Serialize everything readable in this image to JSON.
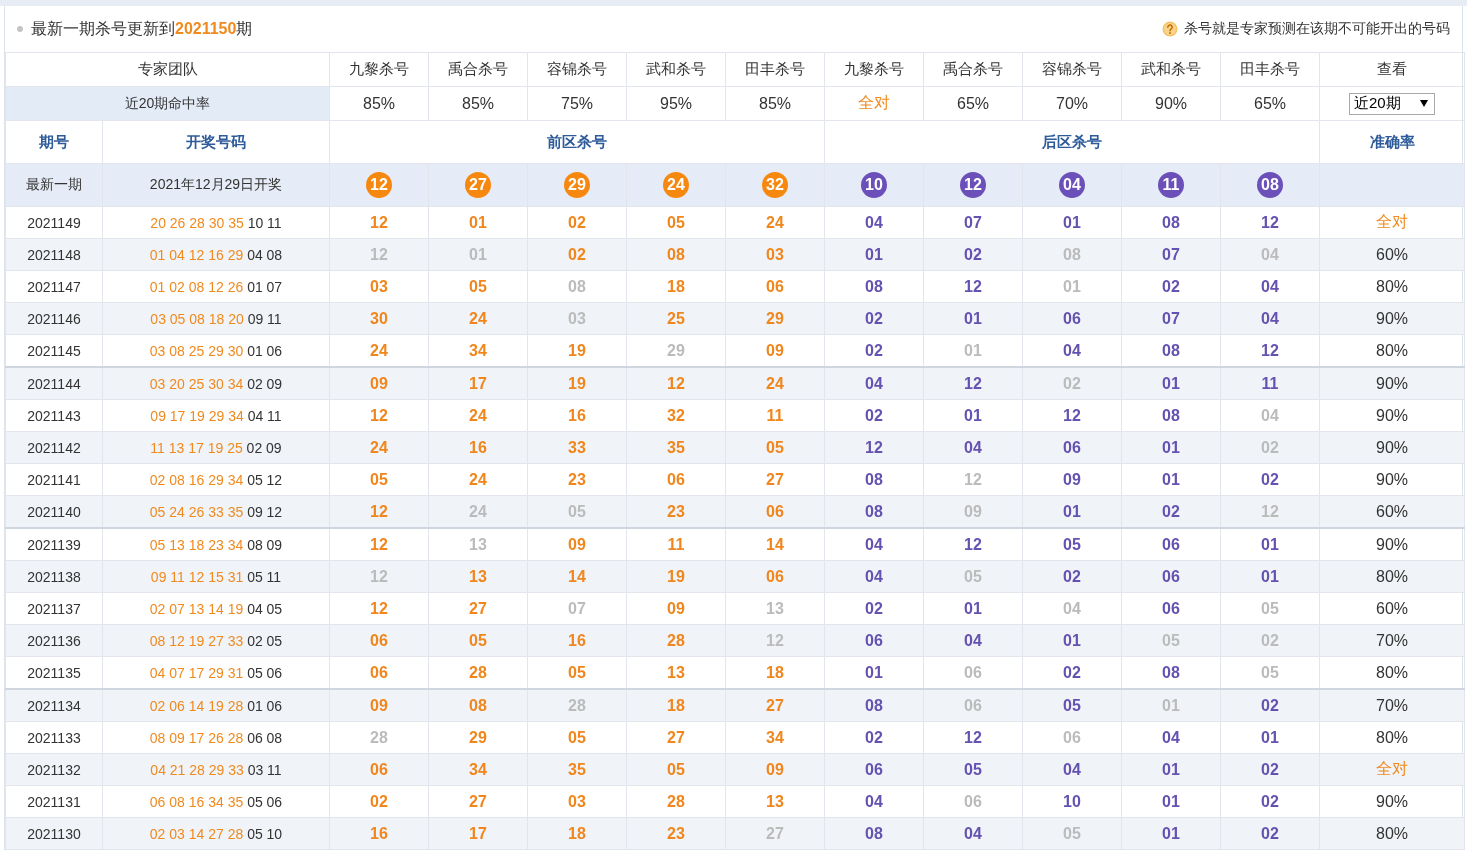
{
  "notice": {
    "text": "最新一期杀号更新到**2021150**期"
  },
  "hint": {
    "text": "杀号就是专家预测在该期不可能开出的号码"
  },
  "experts": {
    "label": "专家团队",
    "columns": [
      "九黎杀号",
      "禹合杀号",
      "容锦杀号",
      "武和杀号",
      "田丰杀号",
      "九黎杀号",
      "禹合杀号",
      "容锦杀号",
      "武和杀号",
      "田丰杀号"
    ],
    "view_label": "查看"
  },
  "hit_rate": {
    "label": "近20期命中率",
    "values": [
      {
        "text": "85%",
        "perfect": false
      },
      {
        "text": "85%",
        "perfect": false
      },
      {
        "text": "75%",
        "perfect": false
      },
      {
        "text": "95%",
        "perfect": false
      },
      {
        "text": "85%",
        "perfect": false
      },
      {
        "text": "全对",
        "perfect": true
      },
      {
        "text": "65%",
        "perfect": false
      },
      {
        "text": "70%",
        "perfect": false
      },
      {
        "text": "90%",
        "perfect": false
      },
      {
        "text": "65%",
        "perfect": false
      }
    ],
    "period_select": {
      "value": "近20期"
    }
  },
  "section_headers": {
    "period": "期号",
    "draw": "开奖号码",
    "front": "前区杀号",
    "back": "后区杀号",
    "accuracy": "准确率"
  },
  "latest": {
    "period": "最新一期",
    "draw_date": "2021年12月29日开奖",
    "front_kills": [
      "12",
      "27",
      "29",
      "24",
      "32"
    ],
    "back_kills": [
      "10",
      "12",
      "04",
      "11",
      "08"
    ]
  },
  "rows": [
    {
      "period": "2021149",
      "front": "20 26 28 30 35",
      "back": "10 11",
      "front_kills": [
        {
          "n": "12",
          "failed": false
        },
        {
          "n": "01",
          "failed": false
        },
        {
          "n": "02",
          "failed": false
        },
        {
          "n": "05",
          "failed": false
        },
        {
          "n": "24",
          "failed": false
        }
      ],
      "back_kills": [
        {
          "n": "04",
          "failed": false
        },
        {
          "n": "07",
          "failed": false
        },
        {
          "n": "01",
          "failed": false
        },
        {
          "n": "08",
          "failed": false
        },
        {
          "n": "12",
          "failed": false
        }
      ],
      "accuracy": {
        "text": "全对",
        "perfect": true
      }
    },
    {
      "period": "2021148",
      "front": "01 04 12 16 29",
      "back": "04 08",
      "front_kills": [
        {
          "n": "12",
          "failed": true
        },
        {
          "n": "01",
          "failed": true
        },
        {
          "n": "02",
          "failed": false
        },
        {
          "n": "08",
          "failed": false
        },
        {
          "n": "03",
          "failed": false
        }
      ],
      "back_kills": [
        {
          "n": "01",
          "failed": false
        },
        {
          "n": "02",
          "failed": false
        },
        {
          "n": "08",
          "failed": true
        },
        {
          "n": "07",
          "failed": false
        },
        {
          "n": "04",
          "failed": true
        }
      ],
      "accuracy": {
        "text": "60%",
        "perfect": false
      }
    },
    {
      "period": "2021147",
      "front": "01 02 08 12 26",
      "back": "01 07",
      "front_kills": [
        {
          "n": "03",
          "failed": false
        },
        {
          "n": "05",
          "failed": false
        },
        {
          "n": "08",
          "failed": true
        },
        {
          "n": "18",
          "failed": false
        },
        {
          "n": "06",
          "failed": false
        }
      ],
      "back_kills": [
        {
          "n": "08",
          "failed": false
        },
        {
          "n": "12",
          "failed": false
        },
        {
          "n": "01",
          "failed": true
        },
        {
          "n": "02",
          "failed": false
        },
        {
          "n": "04",
          "failed": false
        }
      ],
      "accuracy": {
        "text": "80%",
        "perfect": false
      }
    },
    {
      "period": "2021146",
      "front": "03 05 08 18 20",
      "back": "09 11",
      "front_kills": [
        {
          "n": "30",
          "failed": false
        },
        {
          "n": "24",
          "failed": false
        },
        {
          "n": "03",
          "failed": true
        },
        {
          "n": "25",
          "failed": false
        },
        {
          "n": "29",
          "failed": false
        }
      ],
      "back_kills": [
        {
          "n": "02",
          "failed": false
        },
        {
          "n": "01",
          "failed": false
        },
        {
          "n": "06",
          "failed": false
        },
        {
          "n": "07",
          "failed": false
        },
        {
          "n": "04",
          "failed": false
        }
      ],
      "accuracy": {
        "text": "90%",
        "perfect": false
      }
    },
    {
      "period": "2021145",
      "front": "03 08 25 29 30",
      "back": "01 06",
      "front_kills": [
        {
          "n": "24",
          "failed": false
        },
        {
          "n": "34",
          "failed": false
        },
        {
          "n": "19",
          "failed": false
        },
        {
          "n": "29",
          "failed": true
        },
        {
          "n": "09",
          "failed": false
        }
      ],
      "back_kills": [
        {
          "n": "02",
          "failed": false
        },
        {
          "n": "01",
          "failed": true
        },
        {
          "n": "04",
          "failed": false
        },
        {
          "n": "08",
          "failed": false
        },
        {
          "n": "12",
          "failed": false
        }
      ],
      "accuracy": {
        "text": "80%",
        "perfect": false
      }
    },
    {
      "period": "2021144",
      "front": "03 20 25 30 34",
      "back": "02 09",
      "front_kills": [
        {
          "n": "09",
          "failed": false
        },
        {
          "n": "17",
          "failed": false
        },
        {
          "n": "19",
          "failed": false
        },
        {
          "n": "12",
          "failed": false
        },
        {
          "n": "24",
          "failed": false
        }
      ],
      "back_kills": [
        {
          "n": "04",
          "failed": false
        },
        {
          "n": "12",
          "failed": false
        },
        {
          "n": "02",
          "failed": true
        },
        {
          "n": "01",
          "failed": false
        },
        {
          "n": "11",
          "failed": false
        }
      ],
      "accuracy": {
        "text": "90%",
        "perfect": false
      }
    },
    {
      "period": "2021143",
      "front": "09 17 19 29 34",
      "back": "04 11",
      "front_kills": [
        {
          "n": "12",
          "failed": false
        },
        {
          "n": "24",
          "failed": false
        },
        {
          "n": "16",
          "failed": false
        },
        {
          "n": "32",
          "failed": false
        },
        {
          "n": "11",
          "failed": false
        }
      ],
      "back_kills": [
        {
          "n": "02",
          "failed": false
        },
        {
          "n": "01",
          "failed": false
        },
        {
          "n": "12",
          "failed": false
        },
        {
          "n": "08",
          "failed": false
        },
        {
          "n": "04",
          "failed": true
        }
      ],
      "accuracy": {
        "text": "90%",
        "perfect": false
      }
    },
    {
      "period": "2021142",
      "front": "11 13 17 19 25",
      "back": "02 09",
      "front_kills": [
        {
          "n": "24",
          "failed": false
        },
        {
          "n": "16",
          "failed": false
        },
        {
          "n": "33",
          "failed": false
        },
        {
          "n": "35",
          "failed": false
        },
        {
          "n": "05",
          "failed": false
        }
      ],
      "back_kills": [
        {
          "n": "12",
          "failed": false
        },
        {
          "n": "04",
          "failed": false
        },
        {
          "n": "06",
          "failed": false
        },
        {
          "n": "01",
          "failed": false
        },
        {
          "n": "02",
          "failed": true
        }
      ],
      "accuracy": {
        "text": "90%",
        "perfect": false
      }
    },
    {
      "period": "2021141",
      "front": "02 08 16 29 34",
      "back": "05 12",
      "front_kills": [
        {
          "n": "05",
          "failed": false
        },
        {
          "n": "24",
          "failed": false
        },
        {
          "n": "23",
          "failed": false
        },
        {
          "n": "06",
          "failed": false
        },
        {
          "n": "27",
          "failed": false
        }
      ],
      "back_kills": [
        {
          "n": "08",
          "failed": false
        },
        {
          "n": "12",
          "failed": true
        },
        {
          "n": "09",
          "failed": false
        },
        {
          "n": "01",
          "failed": false
        },
        {
          "n": "02",
          "failed": false
        }
      ],
      "accuracy": {
        "text": "90%",
        "perfect": false
      }
    },
    {
      "period": "2021140",
      "front": "05 24 26 33 35",
      "back": "09 12",
      "front_kills": [
        {
          "n": "12",
          "failed": false
        },
        {
          "n": "24",
          "failed": true
        },
        {
          "n": "05",
          "failed": true
        },
        {
          "n": "23",
          "failed": false
        },
        {
          "n": "06",
          "failed": false
        }
      ],
      "back_kills": [
        {
          "n": "08",
          "failed": false
        },
        {
          "n": "09",
          "failed": true
        },
        {
          "n": "01",
          "failed": false
        },
        {
          "n": "02",
          "failed": false
        },
        {
          "n": "12",
          "failed": true
        }
      ],
      "accuracy": {
        "text": "60%",
        "perfect": false
      }
    },
    {
      "period": "2021139",
      "front": "05 13 18 23 34",
      "back": "08 09",
      "front_kills": [
        {
          "n": "12",
          "failed": false
        },
        {
          "n": "13",
          "failed": true
        },
        {
          "n": "09",
          "failed": false
        },
        {
          "n": "11",
          "failed": false
        },
        {
          "n": "14",
          "failed": false
        }
      ],
      "back_kills": [
        {
          "n": "04",
          "failed": false
        },
        {
          "n": "12",
          "failed": false
        },
        {
          "n": "05",
          "failed": false
        },
        {
          "n": "06",
          "failed": false
        },
        {
          "n": "01",
          "failed": false
        }
      ],
      "accuracy": {
        "text": "90%",
        "perfect": false
      }
    },
    {
      "period": "2021138",
      "front": "09 11 12 15 31",
      "back": "05 11",
      "front_kills": [
        {
          "n": "12",
          "failed": true
        },
        {
          "n": "13",
          "failed": false
        },
        {
          "n": "14",
          "failed": false
        },
        {
          "n": "19",
          "failed": false
        },
        {
          "n": "06",
          "failed": false
        }
      ],
      "back_kills": [
        {
          "n": "04",
          "failed": false
        },
        {
          "n": "05",
          "failed": true
        },
        {
          "n": "02",
          "failed": false
        },
        {
          "n": "06",
          "failed": false
        },
        {
          "n": "01",
          "failed": false
        }
      ],
      "accuracy": {
        "text": "80%",
        "perfect": false
      }
    },
    {
      "period": "2021137",
      "front": "02 07 13 14 19",
      "back": "04 05",
      "front_kills": [
        {
          "n": "12",
          "failed": false
        },
        {
          "n": "27",
          "failed": false
        },
        {
          "n": "07",
          "failed": true
        },
        {
          "n": "09",
          "failed": false
        },
        {
          "n": "13",
          "failed": true
        }
      ],
      "back_kills": [
        {
          "n": "02",
          "failed": false
        },
        {
          "n": "01",
          "failed": false
        },
        {
          "n": "04",
          "failed": true
        },
        {
          "n": "06",
          "failed": false
        },
        {
          "n": "05",
          "failed": true
        }
      ],
      "accuracy": {
        "text": "60%",
        "perfect": false
      }
    },
    {
      "period": "2021136",
      "front": "08 12 19 27 33",
      "back": "02 05",
      "front_kills": [
        {
          "n": "06",
          "failed": false
        },
        {
          "n": "05",
          "failed": false
        },
        {
          "n": "16",
          "failed": false
        },
        {
          "n": "28",
          "failed": false
        },
        {
          "n": "12",
          "failed": true
        }
      ],
      "back_kills": [
        {
          "n": "06",
          "failed": false
        },
        {
          "n": "04",
          "failed": false
        },
        {
          "n": "01",
          "failed": false
        },
        {
          "n": "05",
          "failed": true
        },
        {
          "n": "02",
          "failed": true
        }
      ],
      "accuracy": {
        "text": "70%",
        "perfect": false
      }
    },
    {
      "period": "2021135",
      "front": "04 07 17 29 31",
      "back": "05 06",
      "front_kills": [
        {
          "n": "06",
          "failed": false
        },
        {
          "n": "28",
          "failed": false
        },
        {
          "n": "05",
          "failed": false
        },
        {
          "n": "13",
          "failed": false
        },
        {
          "n": "18",
          "failed": false
        }
      ],
      "back_kills": [
        {
          "n": "01",
          "failed": false
        },
        {
          "n": "06",
          "failed": true
        },
        {
          "n": "02",
          "failed": false
        },
        {
          "n": "08",
          "failed": false
        },
        {
          "n": "05",
          "failed": true
        }
      ],
      "accuracy": {
        "text": "80%",
        "perfect": false
      }
    },
    {
      "period": "2021134",
      "front": "02 06 14 19 28",
      "back": "01 06",
      "front_kills": [
        {
          "n": "09",
          "failed": false
        },
        {
          "n": "08",
          "failed": false
        },
        {
          "n": "28",
          "failed": true
        },
        {
          "n": "18",
          "failed": false
        },
        {
          "n": "27",
          "failed": false
        }
      ],
      "back_kills": [
        {
          "n": "08",
          "failed": false
        },
        {
          "n": "06",
          "failed": true
        },
        {
          "n": "05",
          "failed": false
        },
        {
          "n": "01",
          "failed": true
        },
        {
          "n": "02",
          "failed": false
        }
      ],
      "accuracy": {
        "text": "70%",
        "perfect": false
      }
    },
    {
      "period": "2021133",
      "front": "08 09 17 26 28",
      "back": "06 08",
      "front_kills": [
        {
          "n": "28",
          "failed": true
        },
        {
          "n": "29",
          "failed": false
        },
        {
          "n": "05",
          "failed": false
        },
        {
          "n": "27",
          "failed": false
        },
        {
          "n": "34",
          "failed": false
        }
      ],
      "back_kills": [
        {
          "n": "02",
          "failed": false
        },
        {
          "n": "12",
          "failed": false
        },
        {
          "n": "06",
          "failed": true
        },
        {
          "n": "04",
          "failed": false
        },
        {
          "n": "01",
          "failed": false
        }
      ],
      "accuracy": {
        "text": "80%",
        "perfect": false
      }
    },
    {
      "period": "2021132",
      "front": "04 21 28 29 33",
      "back": "03 11",
      "front_kills": [
        {
          "n": "06",
          "failed": false
        },
        {
          "n": "34",
          "failed": false
        },
        {
          "n": "35",
          "failed": false
        },
        {
          "n": "05",
          "failed": false
        },
        {
          "n": "09",
          "failed": false
        }
      ],
      "back_kills": [
        {
          "n": "06",
          "failed": false
        },
        {
          "n": "05",
          "failed": false
        },
        {
          "n": "04",
          "failed": false
        },
        {
          "n": "01",
          "failed": false
        },
        {
          "n": "02",
          "failed": false
        }
      ],
      "accuracy": {
        "text": "全对",
        "perfect": true
      }
    },
    {
      "period": "2021131",
      "front": "06 08 16 34 35",
      "back": "05 06",
      "front_kills": [
        {
          "n": "02",
          "failed": false
        },
        {
          "n": "27",
          "failed": false
        },
        {
          "n": "03",
          "failed": false
        },
        {
          "n": "28",
          "failed": false
        },
        {
          "n": "13",
          "failed": false
        }
      ],
      "back_kills": [
        {
          "n": "04",
          "failed": false
        },
        {
          "n": "06",
          "failed": true
        },
        {
          "n": "10",
          "failed": false
        },
        {
          "n": "01",
          "failed": false
        },
        {
          "n": "02",
          "failed": false
        }
      ],
      "accuracy": {
        "text": "90%",
        "perfect": false
      }
    },
    {
      "period": "2021130",
      "front": "02 03 14 27 28",
      "back": "05 10",
      "front_kills": [
        {
          "n": "16",
          "failed": false
        },
        {
          "n": "17",
          "failed": false
        },
        {
          "n": "18",
          "failed": false
        },
        {
          "n": "23",
          "failed": false
        },
        {
          "n": "27",
          "failed": true
        }
      ],
      "back_kills": [
        {
          "n": "08",
          "failed": false
        },
        {
          "n": "04",
          "failed": false
        },
        {
          "n": "05",
          "failed": true
        },
        {
          "n": "01",
          "failed": false
        },
        {
          "n": "02",
          "failed": false
        }
      ],
      "accuracy": {
        "text": "80%",
        "perfect": false
      }
    }
  ]
}
